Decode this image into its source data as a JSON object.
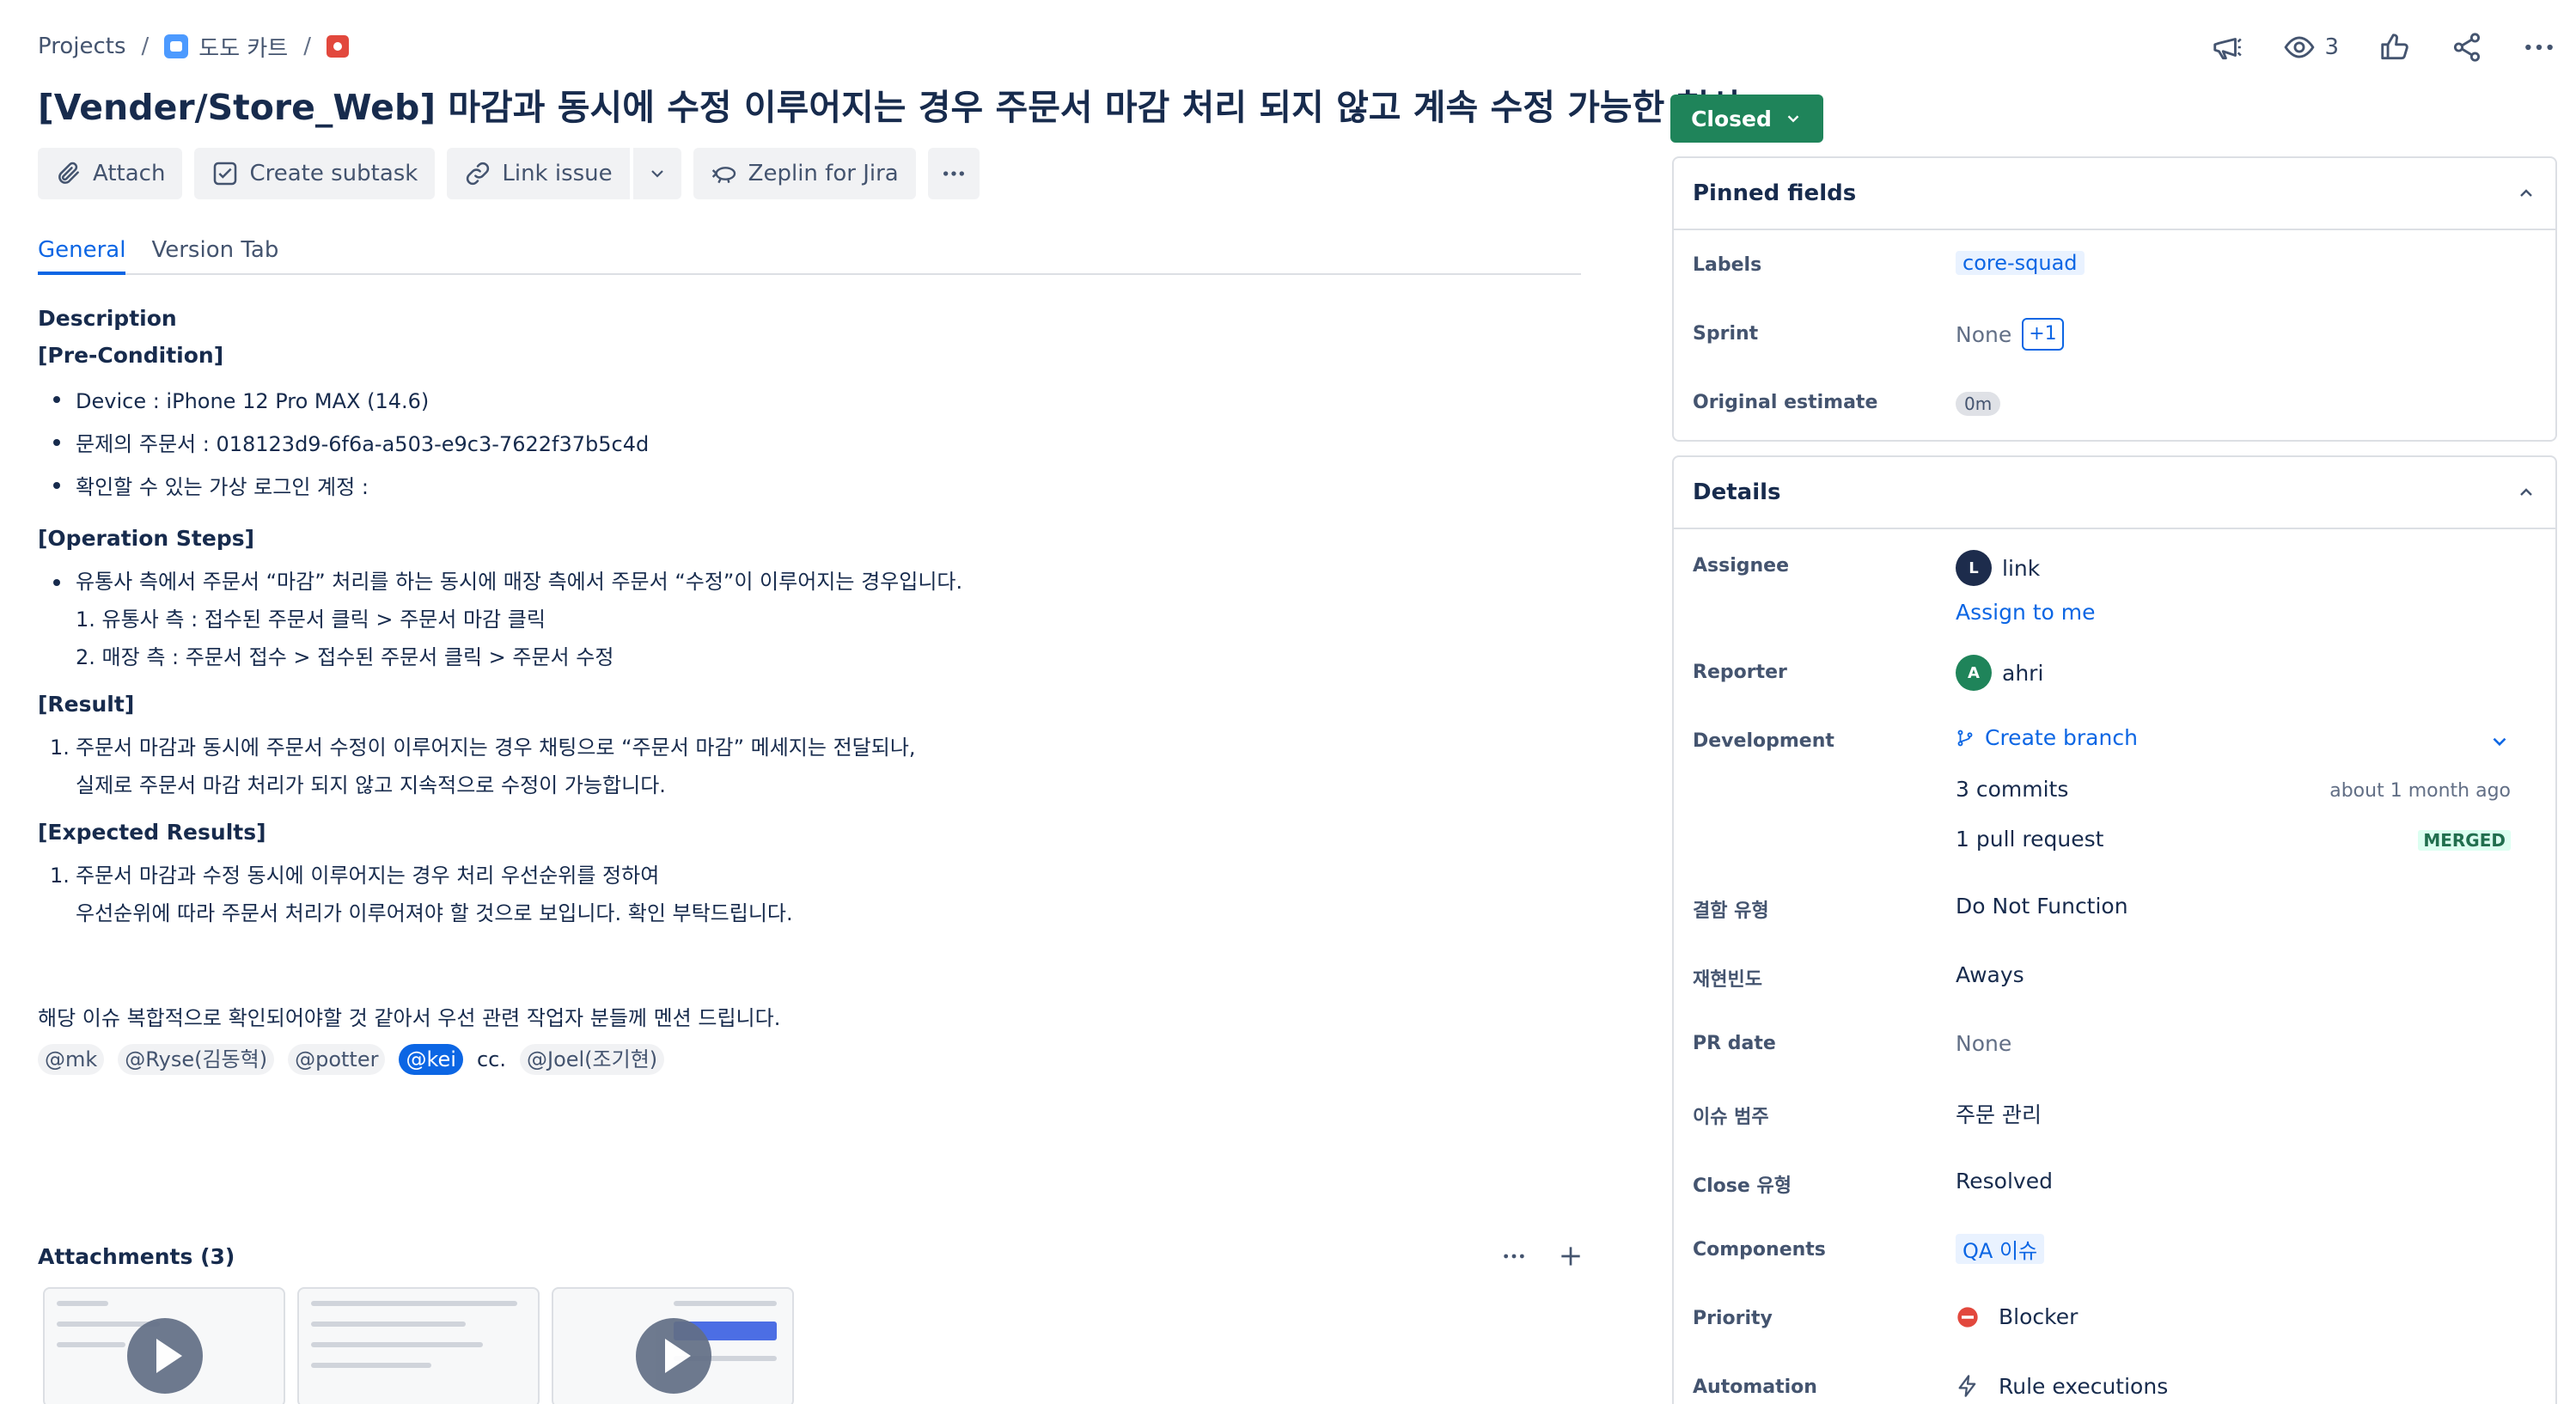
{
  "breadcrumb": {
    "projects": "Projects",
    "separator": "/",
    "project_name": "도도 카트"
  },
  "top_actions": {
    "watch_count": "3"
  },
  "issue": {
    "title": "[Vender/Store_Web] 마감과 동시에 수정 이루어지는 경우 주문서 마감 처리 되지 않고 계속 수정 가능한 현상",
    "status": "Closed"
  },
  "toolbar": {
    "attach": "Attach",
    "create_subtask": "Create subtask",
    "link_issue": "Link issue",
    "zeplin": "Zeplin for Jira"
  },
  "tabs": [
    "General",
    "Version Tab"
  ],
  "description": {
    "heading": "Description",
    "pre_condition": {
      "title": "[Pre-Condition]",
      "items": [
        "Device : iPhone 12 Pro MAX (14.6)",
        "문제의 주문서 : 018123d9-6f6a-a503-e9c3-7622f37b5c4d",
        "확인할 수 있는 가상 로그인 계정 :"
      ]
    },
    "operation_steps": {
      "title": "[Operation Steps]",
      "bullet": "유통사 측에서 주문서 “마감” 처리를 하는 동시에 매장 측에서 주문서 “수정”이 이루어지는 경우입니다.",
      "steps": [
        "1. 유통사 측 : 접수된 주문서 클릭 > 주문서 마감 클릭",
        "2. 매장 측 : 주문서 접수 > 접수된 주문서 클릭 > 주문서 수정"
      ]
    },
    "result": {
      "title": "[Result]",
      "num": "1.",
      "line1": "주문서 마감과 동시에 주문서 수정이 이루어지는 경우 채팅으로 “주문서 마감” 메세지는 전달되나,",
      "line2": "실제로 주문서 마감 처리가 되지 않고 지속적으로 수정이 가능합니다."
    },
    "expected": {
      "title": "[Expected Results]",
      "num": "1.",
      "line1": "주문서 마감과 수정 동시에 이루어지는 경우 처리 우선순위를 정하여",
      "line2": "우선순위에 따라 주문서 처리가 이루어져야 할 것으로 보입니다. 확인 부탁드립니다."
    },
    "note": "해당 이슈 복합적으로 확인되어야할 것 같아서 우선 관련 작업자 분들께 멘션 드립니다.",
    "mentions": [
      "@mk",
      "@Ryse(김동혁)",
      "@potter",
      "@kei"
    ],
    "cc": "cc.",
    "cc_mention": "@Joel(조기현)"
  },
  "attachments": {
    "title": "Attachments (3)"
  },
  "pinned": {
    "title": "Pinned fields",
    "labels_label": "Labels",
    "labels_value": "core-squad",
    "sprint_label": "Sprint",
    "sprint_value": "None",
    "sprint_extra": "+1",
    "estimate_label": "Original estimate",
    "estimate_value": "0m"
  },
  "details": {
    "title": "Details",
    "assignee_label": "Assignee",
    "assignee_initial": "L",
    "assignee_name": "link",
    "assign_to_me": "Assign to me",
    "reporter_label": "Reporter",
    "reporter_initial": "A",
    "reporter_name": "ahri",
    "development_label": "Development",
    "create_branch": "Create branch",
    "commits": "3 commits",
    "commits_time": "about 1 month ago",
    "pull_request": "1 pull request",
    "pr_status": "MERGED",
    "defect_type_label": "결함 유형",
    "defect_type_value": "Do Not Function",
    "frequency_label": "재현빈도",
    "frequency_value": "Aways",
    "pr_date_label": "PR date",
    "pr_date_value": "None",
    "category_label": "이슈 범주",
    "category_value": "주문 관리",
    "close_type_label": "Close 유형",
    "close_type_value": "Resolved",
    "components_label": "Components",
    "components_value": "QA 이슈",
    "priority_label": "Priority",
    "priority_value": "Blocker",
    "automation_label": "Automation",
    "automation_value": "Rule executions"
  },
  "colors": {
    "accent": "#0c66e4",
    "status_closed": "#1f845a",
    "priority_blocker": "#e2483d"
  }
}
